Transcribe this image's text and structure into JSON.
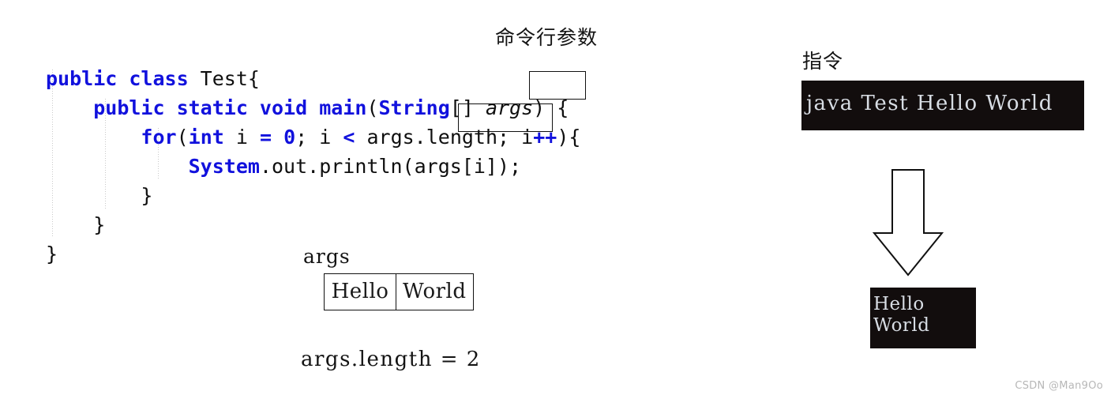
{
  "page": {
    "title_cjk": "命令行参数",
    "watermark": "CSDN @Man9Oo"
  },
  "code": {
    "language": "java",
    "colors": {
      "keyword": "#1111dd",
      "plain": "#0f0f0f",
      "guide": "#c9c9c9"
    },
    "lines": [
      {
        "indent": 0,
        "tokens": [
          {
            "t": "public class ",
            "k": true
          },
          {
            "t": "Test{",
            "k": false
          }
        ]
      },
      {
        "indent": 1,
        "tokens": [
          {
            "t": "public static void main",
            "k": true
          },
          {
            "t": "(",
            "k": false
          },
          {
            "t": "String",
            "k": true
          },
          {
            "t": "[] ",
            "k": false
          },
          {
            "t": "args",
            "k": false,
            "italic": true,
            "boxed": true
          },
          {
            "t": ") {",
            "k": false
          }
        ]
      },
      {
        "indent": 2,
        "tokens": [
          {
            "t": "for",
            "k": true
          },
          {
            "t": "(",
            "k": false
          },
          {
            "t": "int",
            "k": true
          },
          {
            "t": " i ",
            "k": false
          },
          {
            "t": "=",
            "k": true
          },
          {
            "t": " ",
            "k": false
          },
          {
            "t": "0",
            "k": true
          },
          {
            "t": "; i ",
            "k": false
          },
          {
            "t": "<",
            "k": true
          },
          {
            "t": " args",
            "k": false
          },
          {
            "t": ".length;",
            "k": false,
            "boxed": true
          },
          {
            "t": " i",
            "k": false
          },
          {
            "t": "++",
            "k": true
          },
          {
            "t": "){",
            "k": false
          }
        ]
      },
      {
        "indent": 3,
        "tokens": [
          {
            "t": "System",
            "k": true
          },
          {
            "t": ".out.println(args[i]);",
            "k": false
          }
        ]
      },
      {
        "indent": 2,
        "tokens": [
          {
            "t": "}",
            "k": false
          }
        ]
      },
      {
        "indent": 1,
        "tokens": [
          {
            "t": "}",
            "k": false
          }
        ]
      },
      {
        "indent": 0,
        "tokens": [
          {
            "t": "}",
            "k": false
          }
        ]
      }
    ],
    "line_strings": [
      "public class Test{",
      "    public static void main(String[] args) {",
      "        for(int i = 0; i < args.length; i++){",
      "            System.out.println(args[i]);",
      "        }",
      "    }",
      "}"
    ]
  },
  "args_diagram": {
    "label": "args",
    "cells": [
      "Hello",
      "World"
    ],
    "length_text": "args.length = 2"
  },
  "command_panel": {
    "label_cjk": "指令",
    "command_text": "java Test Hello World",
    "terminal_bg": "#120d0d",
    "terminal_fg": "#d8dde4"
  },
  "output_panel": {
    "lines": [
      "Hello",
      "World"
    ],
    "text": "Hello\nWorld"
  },
  "arrow": {
    "direction": "down",
    "stroke": "#111111",
    "fill": "#ffffff"
  }
}
